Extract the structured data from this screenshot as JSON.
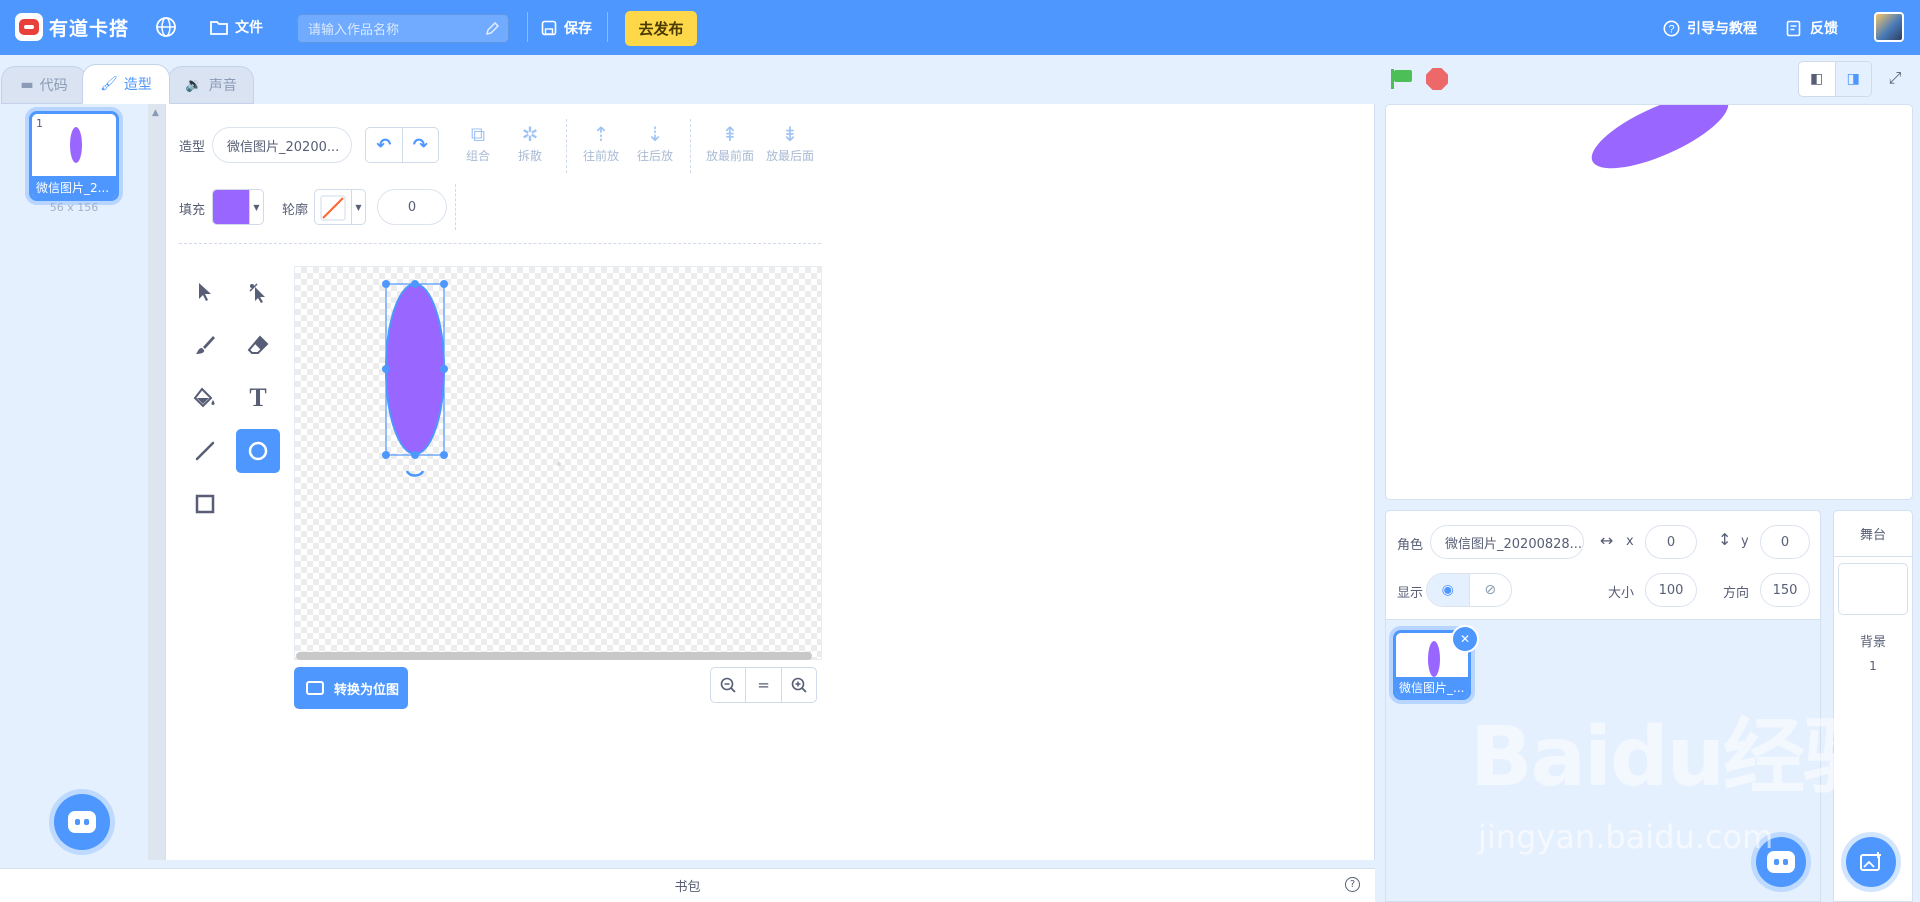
{
  "header": {
    "brand": "有道卡搭",
    "file_menu": "文件",
    "title_placeholder": "请输入作品名称",
    "save_label": "保存",
    "publish_label": "去发布",
    "guide_label": "引导与教程",
    "feedback_label": "反馈"
  },
  "tabs": [
    {
      "label": "代码",
      "icon": "code-icon"
    },
    {
      "label": "造型",
      "icon": "brush-icon",
      "active": true
    },
    {
      "label": "声音",
      "icon": "sound-icon"
    }
  ],
  "costumes": [
    {
      "index": "1",
      "name": "微信图片_2...",
      "size": "56 x 156"
    }
  ],
  "editor": {
    "costume_label": "造型",
    "costume_name": "微信图片_20200...",
    "group_label": "组合",
    "ungroup_label": "拆散",
    "forward_label": "往前放",
    "backward_label": "往后放",
    "front_label": "放最前面",
    "back_label": "放最后面",
    "fill_label": "填充",
    "fill_color": "#9966ff",
    "outline_label": "轮廓",
    "outline_width": "0",
    "convert_label": "转换为位图",
    "active_tool": "circle-tool"
  },
  "backpack_label": "书包",
  "sprite": {
    "role_label": "角色",
    "name": "微信图片_20200828...",
    "x_label": "x",
    "x": "0",
    "y_label": "y",
    "y": "0",
    "show_label": "显示",
    "size_label": "大小",
    "size": "100",
    "direction_label": "方向",
    "direction": "150",
    "tile_label": "微信图片_..."
  },
  "stage_panel": {
    "header": "舞台",
    "backdrop_label": "背景",
    "backdrop_count": "1"
  },
  "watermark": {
    "logo": "Baidu经验",
    "url": "jingyan.baidu.com"
  },
  "colors": {
    "accent": "#4d97ff",
    "sprite_fill": "#9966ff",
    "publish": "#ffd84a"
  }
}
